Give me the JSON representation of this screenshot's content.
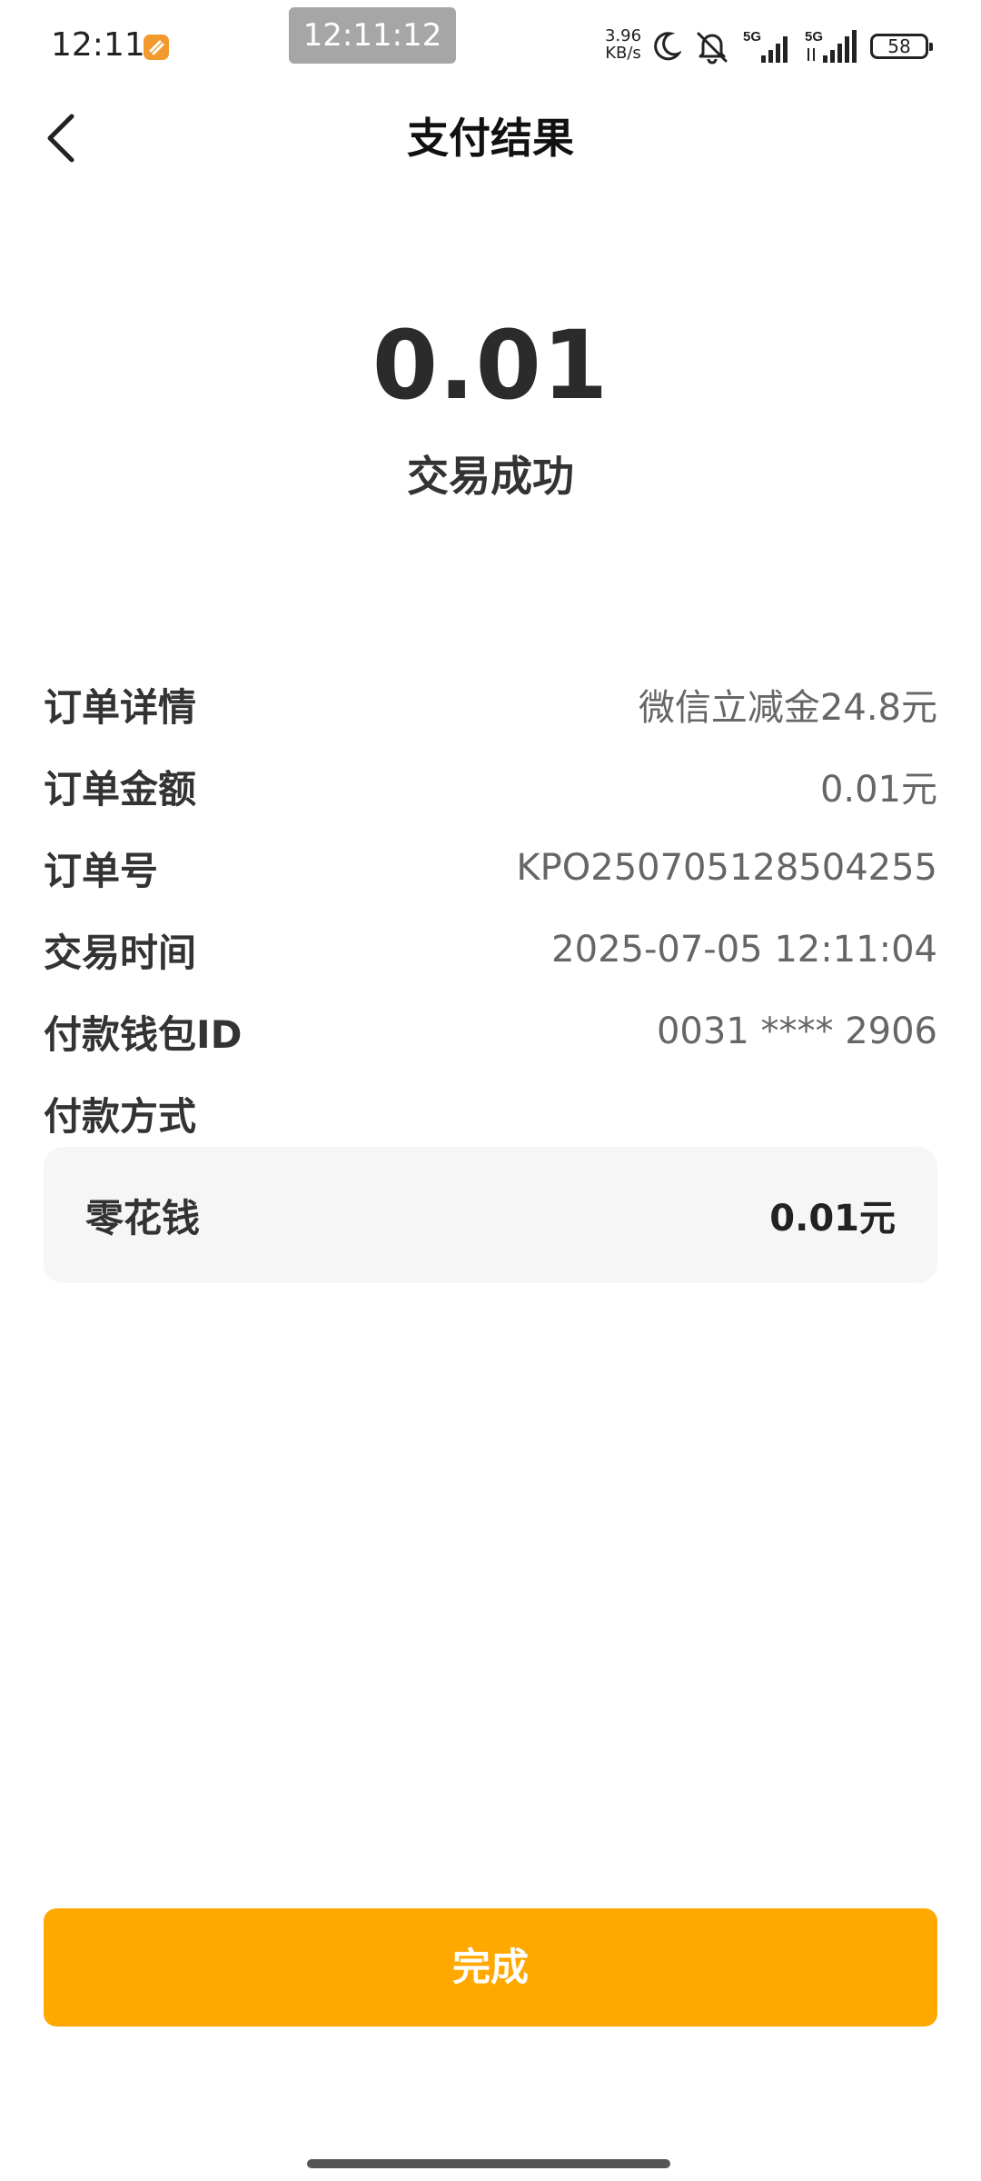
{
  "status_bar": {
    "time": "12:11",
    "screen_timer": "12:11:12",
    "net_speed_value": "3.96",
    "net_speed_unit": "KB/s",
    "signal_1_label": "5G",
    "signal_2_label": "5G",
    "battery": "58",
    "icons": [
      "app-notification-icon",
      "moon-icon",
      "muted-bell-icon",
      "signal-icon",
      "battery-icon"
    ]
  },
  "nav": {
    "title": "支付结果",
    "back_icon": "chevron-left-icon"
  },
  "result": {
    "amount": "0.01",
    "status": "交易成功"
  },
  "details": {
    "rows": [
      {
        "label": "订单详情",
        "value": "微信立减金24.8元"
      },
      {
        "label": "订单金额",
        "value": "0.01元"
      },
      {
        "label": "订单号",
        "value": "KPO250705128504255"
      },
      {
        "label": "交易时间",
        "value": "2025-07-05 12:11:04"
      },
      {
        "label": "付款钱包ID",
        "value": "0031 **** 2906"
      }
    ],
    "method_label": "付款方式",
    "method": {
      "name": "零花钱",
      "amount": "0.01元"
    }
  },
  "actions": {
    "done_label": "完成"
  },
  "colors": {
    "accent": "#ffa800",
    "card_bg": "#f6f6f6",
    "app_icon": "#f29a2e"
  }
}
